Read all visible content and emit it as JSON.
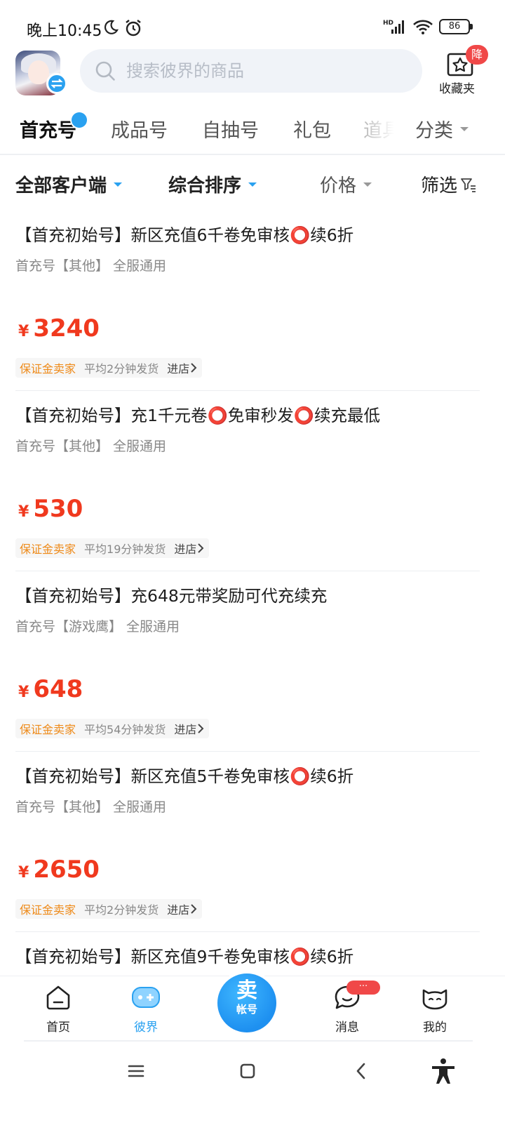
{
  "status_bar": {
    "time": "晚上10:45",
    "battery": "86",
    "network": "HD"
  },
  "header": {
    "search_placeholder": "搜索彼界的商品",
    "favorites_label": "收藏夹",
    "favorites_badge": "降"
  },
  "tabs": [
    {
      "label": "首充号",
      "active": true
    },
    {
      "label": "成品号",
      "active": false
    },
    {
      "label": "自抽号",
      "active": false
    },
    {
      "label": "礼包",
      "active": false
    },
    {
      "label": "道具",
      "active": false
    },
    {
      "label": "分类",
      "active": false
    }
  ],
  "filters": {
    "client": "全部客户端",
    "sort": "综合排序",
    "price": "价格",
    "filter": "筛选"
  },
  "listings": [
    {
      "title": "【首充初始号】新区充值6千卷免审核⭕续6折",
      "sub": "首充号【其他】 全服通用",
      "currency": "¥",
      "price": "3240",
      "seller": "保证金卖家",
      "ship": "平均2分钟发货",
      "shop": "进店"
    },
    {
      "title": "【首充初始号】充1千元卷⭕免审秒发⭕续充最低",
      "sub": "首充号【其他】 全服通用",
      "currency": "¥",
      "price": "530",
      "seller": "保证金卖家",
      "ship": "平均19分钟发货",
      "shop": "进店"
    },
    {
      "title": "【首充初始号】充648元带奖励可代充续充",
      "sub": "首充号【游戏鹰】 全服通用",
      "currency": "¥",
      "price": "648",
      "seller": "保证金卖家",
      "ship": "平均54分钟发货",
      "shop": "进店"
    },
    {
      "title": "【首充初始号】新区充值5千卷免审核⭕续6折",
      "sub": "首充号【其他】 全服通用",
      "currency": "¥",
      "price": "2650",
      "seller": "保证金卖家",
      "ship": "平均2分钟发货",
      "shop": "进店"
    },
    {
      "title": "【首充初始号】新区充值9千卷免审核⭕续6折"
    }
  ],
  "bottom_nav": {
    "home": "首页",
    "bijie": "彼界",
    "sell_big": "卖",
    "sell_small": "帐号",
    "messages": "消息",
    "messages_badge": "···",
    "mine": "我的"
  },
  "colors": {
    "accent": "#2aa1f0",
    "price": "#f0391e",
    "seller_tag": "#ee8a19",
    "badge": "#f04848"
  }
}
